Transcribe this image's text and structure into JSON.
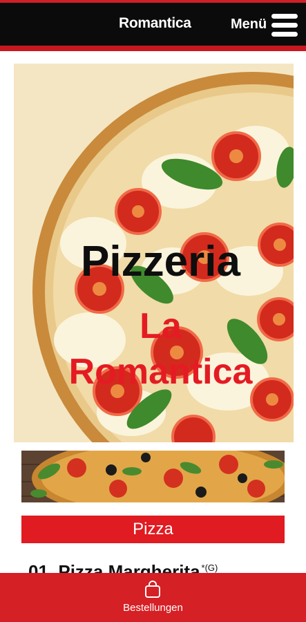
{
  "header": {
    "brand": "Romantica",
    "menu_label": "Menü"
  },
  "hero": {
    "title": "Pizzeria",
    "subtitle_line1": "La",
    "subtitle_line2": "Romantica"
  },
  "section": {
    "title": "Pizza"
  },
  "menu_items": [
    {
      "name": "01. Pizza Margherita",
      "markers": "*(G)"
    }
  ],
  "bottom_nav": {
    "label": "Bestellungen",
    "icon": "shopping-bag-icon"
  },
  "colors": {
    "accent": "#e01b21",
    "header_bg": "#0b0b0b",
    "hero_bg": "#f4e6c2"
  }
}
